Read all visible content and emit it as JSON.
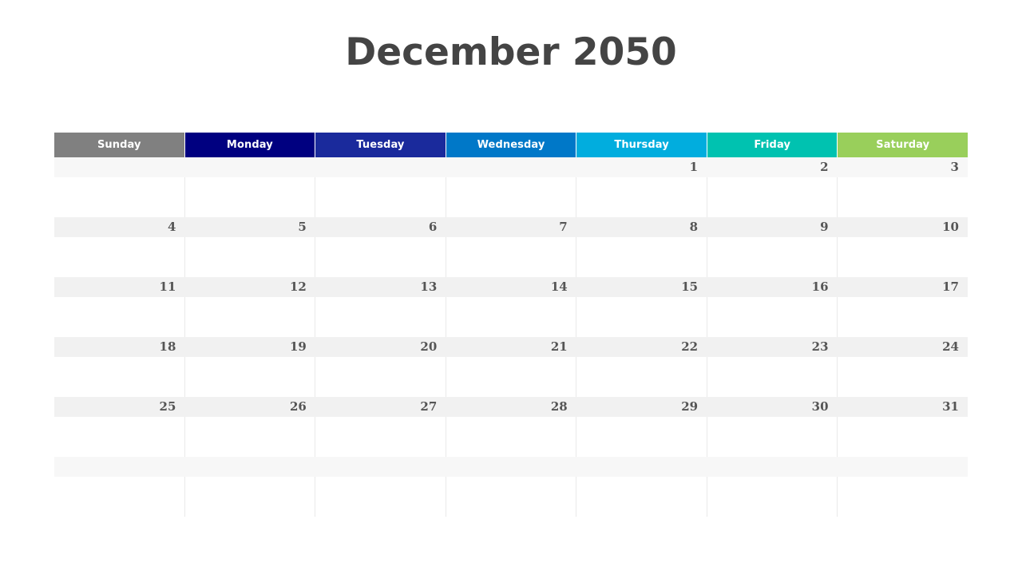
{
  "title": "December 2050",
  "weekdays": [
    {
      "label": "Sunday",
      "color": "#808080"
    },
    {
      "label": "Monday",
      "color": "#000080"
    },
    {
      "label": "Tuesday",
      "color": "#1a2a9c"
    },
    {
      "label": "Wednesday",
      "color": "#0078c8"
    },
    {
      "label": "Thursday",
      "color": "#01adde"
    },
    {
      "label": "Friday",
      "color": "#00c2b0"
    },
    {
      "label": "Saturday",
      "color": "#99cf5b"
    }
  ],
  "weeks": [
    {
      "faint": true,
      "days": [
        "",
        "",
        "",
        "",
        "1",
        "2",
        "3"
      ]
    },
    {
      "faint": false,
      "days": [
        "4",
        "5",
        "6",
        "7",
        "8",
        "9",
        "10"
      ]
    },
    {
      "faint": false,
      "days": [
        "11",
        "12",
        "13",
        "14",
        "15",
        "16",
        "17"
      ]
    },
    {
      "faint": false,
      "days": [
        "18",
        "19",
        "20",
        "21",
        "22",
        "23",
        "24"
      ]
    },
    {
      "faint": false,
      "days": [
        "25",
        "26",
        "27",
        "28",
        "29",
        "30",
        "31"
      ]
    },
    {
      "faint": true,
      "days": [
        "",
        "",
        "",
        "",
        "",
        "",
        ""
      ]
    }
  ]
}
